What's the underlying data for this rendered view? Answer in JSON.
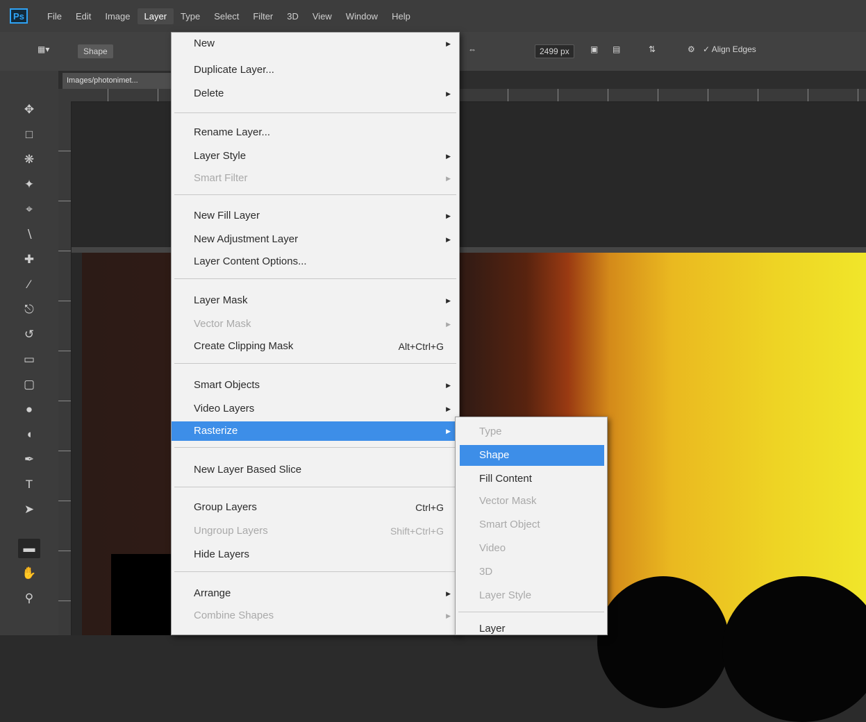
{
  "app": {
    "logo": "Ps"
  },
  "menubar": {
    "items": [
      "File",
      "Edit",
      "Image",
      "Layer",
      "Type",
      "Select",
      "Filter",
      "3D",
      "View",
      "Window",
      "Help"
    ],
    "active_index": 3
  },
  "options_bar": {
    "mode": "Shape",
    "width": "2499 px",
    "align_edges": "Align Edges"
  },
  "document": {
    "tab_title": "Images/photonimet..."
  },
  "layer_menu": {
    "items": [
      {
        "label": "New",
        "submenu": true
      },
      {
        "label": "Duplicate Layer..."
      },
      {
        "label": "Delete",
        "submenu": true
      },
      {
        "label": "Rename Layer..."
      },
      {
        "label": "Layer Style",
        "submenu": true
      },
      {
        "label": "Smart Filter",
        "submenu": true,
        "disabled": true
      },
      {
        "label": "New Fill Layer",
        "submenu": true
      },
      {
        "label": "New Adjustment Layer",
        "submenu": true
      },
      {
        "label": "Layer Content Options..."
      },
      {
        "label": "Layer Mask",
        "submenu": true
      },
      {
        "label": "Vector Mask",
        "submenu": true,
        "disabled": true
      },
      {
        "label": "Create Clipping Mask",
        "shortcut": "Alt+Ctrl+G"
      },
      {
        "label": "Smart Objects",
        "submenu": true
      },
      {
        "label": "Video Layers",
        "submenu": true
      },
      {
        "label": "Rasterize",
        "submenu": true,
        "highlighted": true
      },
      {
        "label": "New Layer Based Slice"
      },
      {
        "label": "Group Layers",
        "shortcut": "Ctrl+G"
      },
      {
        "label": "Ungroup Layers",
        "shortcut": "Shift+Ctrl+G",
        "disabled": true
      },
      {
        "label": "Hide Layers"
      },
      {
        "label": "Arrange",
        "submenu": true
      },
      {
        "label": "Combine Shapes",
        "submenu": true,
        "disabled": true
      }
    ]
  },
  "rasterize_submenu": {
    "items": [
      {
        "label": "Type",
        "disabled": true
      },
      {
        "label": "Shape",
        "highlighted": true
      },
      {
        "label": "Fill Content"
      },
      {
        "label": "Vector Mask",
        "disabled": true
      },
      {
        "label": "Smart Object",
        "disabled": true
      },
      {
        "label": "Video",
        "disabled": true
      },
      {
        "label": "3D",
        "disabled": true
      },
      {
        "label": "Layer Style",
        "disabled": true
      },
      {
        "label": "Layer"
      }
    ]
  },
  "colors": {
    "highlight": "#3d8ee8",
    "menu_bg": "#f2f2f2",
    "app_bg": "#2b2b2b"
  }
}
